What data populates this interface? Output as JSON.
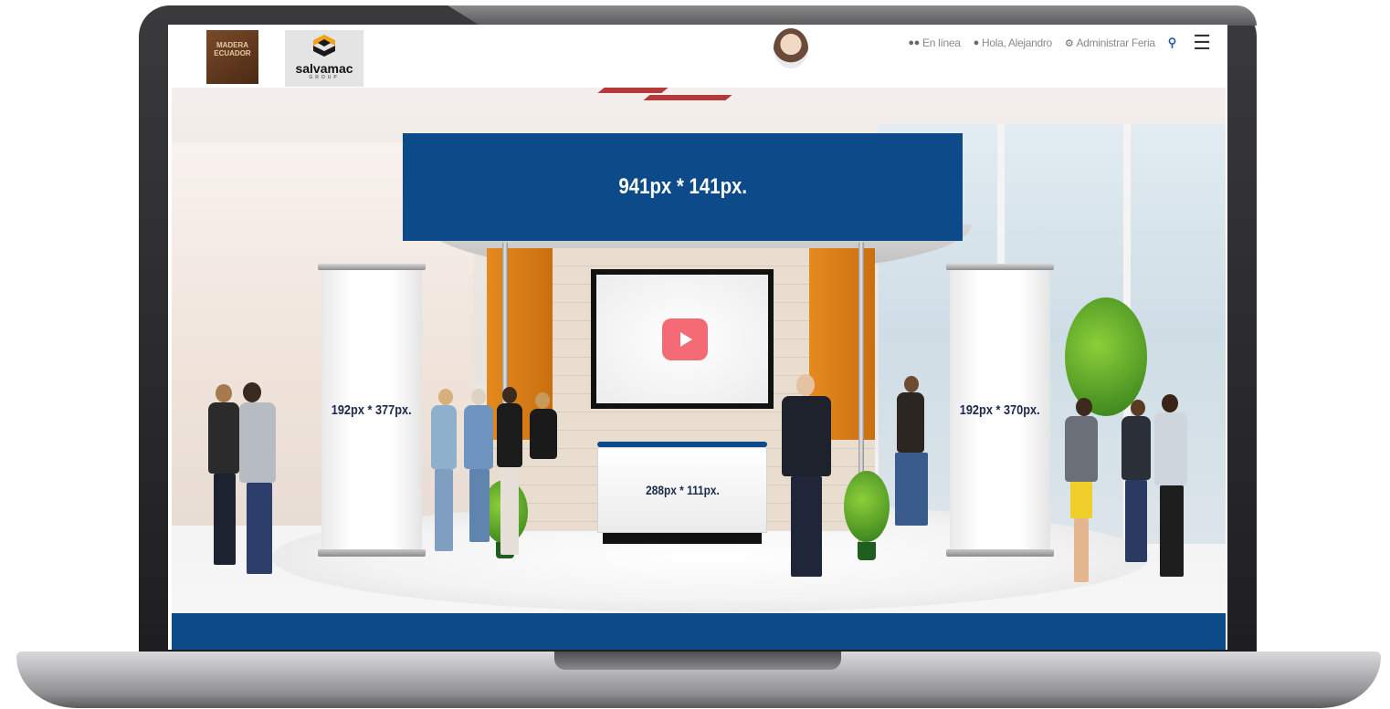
{
  "header": {
    "logos": [
      {
        "name": "Madera Ecuador",
        "text": "MADERA ECUADOR"
      },
      {
        "name": "Salvamac Group",
        "text": "salvamac",
        "subtext": "GROUP"
      }
    ],
    "nav": [
      {
        "icon": "users-icon",
        "label": "En línea"
      },
      {
        "icon": "user-icon",
        "label": "Hola, Alejandro"
      },
      {
        "icon": "gears-icon",
        "label": "Administrar Feria"
      }
    ],
    "search_icon": "search-icon",
    "menu_icon": "hamburger-menu-icon"
  },
  "booth": {
    "banner_label": "941px * 141px.",
    "left_rollup_label": "192px * 377px.",
    "right_rollup_label": "192px * 370px.",
    "counter_label": "288px * 111px.",
    "video_icon": "play-icon"
  },
  "colors": {
    "brand_blue": "#0d4a8a",
    "accent_orange": "#e58a1f",
    "play_red": "#f36a74"
  }
}
